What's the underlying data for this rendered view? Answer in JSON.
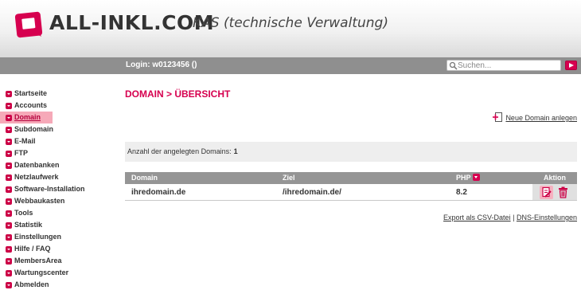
{
  "header": {
    "brand": "ALL-INKL.COM",
    "subtitle": "KAS (technische Verwaltung)"
  },
  "topbar": {
    "login": "Login: w0123456 ()",
    "search_placeholder": "Suchen..."
  },
  "sidebar": {
    "items": [
      {
        "label": "Startseite"
      },
      {
        "label": "Accounts"
      },
      {
        "label": "Domain",
        "active": true
      },
      {
        "label": "Subdomain"
      },
      {
        "label": "E-Mail"
      },
      {
        "label": "FTP"
      },
      {
        "label": "Datenbanken"
      },
      {
        "label": "Netzlaufwerk"
      },
      {
        "label": "Software-Installation"
      },
      {
        "label": "Webbaukasten"
      },
      {
        "label": "Tools"
      },
      {
        "label": "Statistik"
      },
      {
        "label": "Einstellungen"
      },
      {
        "label": "Hilfe / FAQ"
      },
      {
        "label": "MembersArea"
      },
      {
        "label": "Wartungscenter"
      },
      {
        "label": "Abmelden"
      }
    ]
  },
  "main": {
    "title": "DOMAIN > ÜBERSICHT",
    "add_domain_label": "Neue Domain anlegen",
    "count_label": "Anzahl der angelegten Domains:",
    "count_value": "1",
    "table": {
      "headers": {
        "domain": "Domain",
        "ziel": "Ziel",
        "php": "PHP",
        "aktion": "Aktion"
      },
      "rows": [
        {
          "domain": "ihredomain.de",
          "ziel": "/ihredomain.de/",
          "php": "8.2"
        }
      ]
    },
    "footer": {
      "export": "Export als CSV-Datei",
      "separator": "|",
      "dns": "DNS-Einstellungen"
    }
  },
  "colors": {
    "accent": "#d6004f",
    "bar": "#8f8f8f",
    "active_nav": "#f6a9b8"
  },
  "icons": [
    "logo-icon",
    "search-icon",
    "search-go-icon",
    "nav-bullet-icon",
    "add-domain-icon",
    "sort-desc-icon",
    "edit-icon",
    "trash-icon"
  ]
}
